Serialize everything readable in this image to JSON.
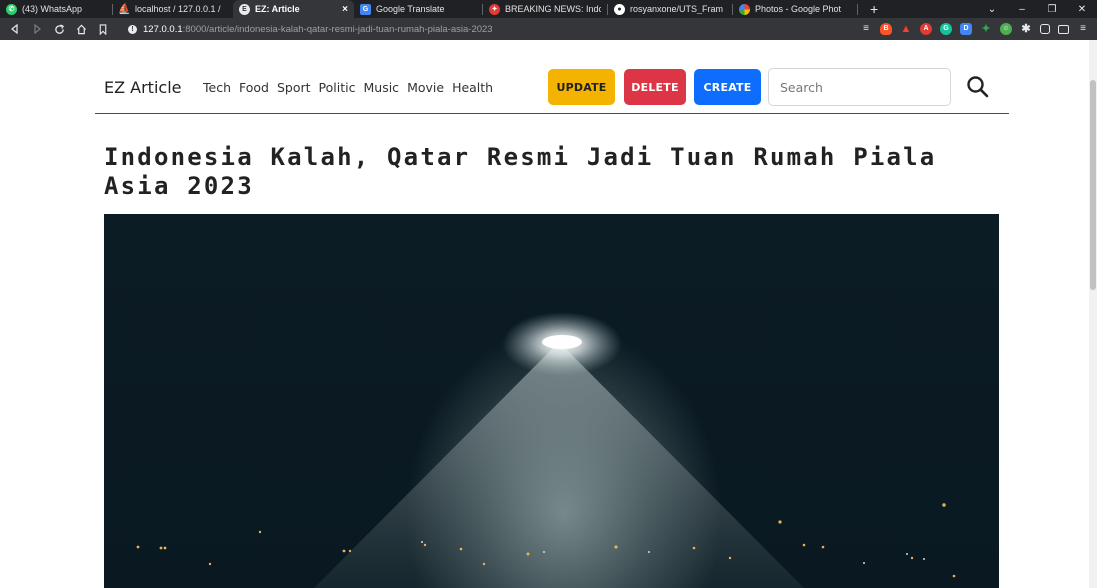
{
  "browser": {
    "tabs": [
      {
        "title": "(43) WhatsApp",
        "icon": "whatsapp-icon",
        "color": "#25d366",
        "active": false
      },
      {
        "title": "localhost / 127.0.0.1 / ",
        "icon": "phpmyadmin-icon",
        "color": "#f29111",
        "active": false
      },
      {
        "title": "EZ: Article",
        "icon": "ez-icon",
        "color": "#ffffff",
        "active": true
      },
      {
        "title": "Google Translate",
        "icon": "translate-icon",
        "color": "#4285f4",
        "active": false
      },
      {
        "title": "BREAKING NEWS: Indo",
        "icon": "news-icon",
        "color": "#e53935",
        "active": false
      },
      {
        "title": "rosyanxone/UTS_Fram",
        "icon": "github-icon",
        "color": "#ffffff",
        "active": false
      },
      {
        "title": "Photos - Google Phot",
        "icon": "photos-icon",
        "color": "#fbbc04",
        "active": false
      }
    ],
    "address": {
      "host": "127.0.0.1",
      "rest": ":8000/article/indonesia-kalah-qatar-resmi-jadi-tuan-rumah-piala-asia-2023"
    },
    "close_tab_glyph": "×",
    "new_tab_glyph": "+"
  },
  "site": {
    "brand": "EZ Article",
    "menu": [
      "Tech",
      "Food",
      "Sport",
      "Politic",
      "Music",
      "Movie",
      "Health"
    ],
    "buttons": {
      "update": "UPDATE",
      "delete": "DELETE",
      "create": "CREATE"
    },
    "search": {
      "placeholder": "Search"
    },
    "colors": {
      "update": "#f4b300",
      "delete": "#dc3545",
      "create": "#0d6efd"
    }
  },
  "article": {
    "title": "Indonesia Kalah, Qatar Resmi Jadi Tuan Rumah Piala Asia 2023"
  }
}
